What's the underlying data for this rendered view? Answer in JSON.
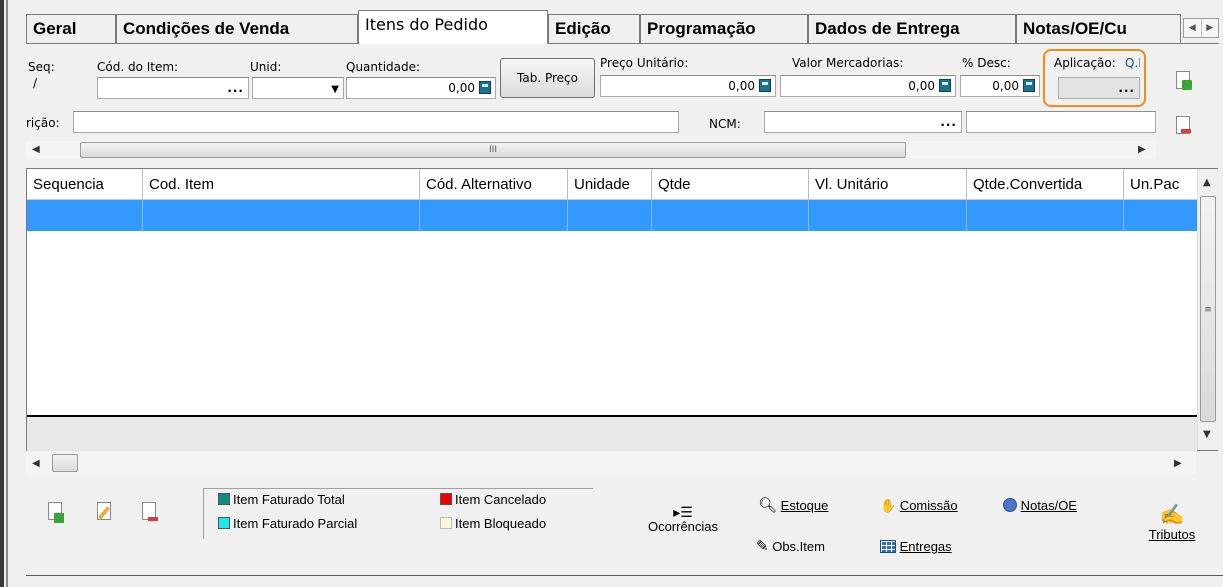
{
  "tabs": [
    {
      "label": "Geral"
    },
    {
      "label": "Condições de Venda"
    },
    {
      "label": "Itens do Pedido"
    },
    {
      "label": "Edição"
    },
    {
      "label": "Programação"
    },
    {
      "label": "Dados de Entrega"
    },
    {
      "label": "Notas/OE/Cu"
    }
  ],
  "form": {
    "seq_label": "Seq:",
    "seq_value": "/",
    "cod_item_label": "Cód. do Item:",
    "unid_label": "Unid:",
    "quantidade_label": "Quantidade:",
    "quantidade_value": "0,00",
    "tab_preco_label": "Tab. Preço",
    "preco_unitario_label": "Preço Unitário:",
    "preco_unitario_value": "0,00",
    "valor_mercadorias_label": "Valor Mercadorias:",
    "valor_mercadorias_value": "0,00",
    "desc_label": "% Desc:",
    "desc_value": "0,00",
    "aplicacao_label": "Aplicação:",
    "aplicacao_extra": "Q.I",
    "descricao_label": "rição:",
    "ncm_label": "NCM:",
    "dots": "..."
  },
  "grid": {
    "columns": [
      "Sequencia",
      "Cod. Item",
      "Cód. Alternativo",
      "Unidade",
      "Qtde",
      "Vl. Unitário",
      "Qtde.Convertida",
      "Un.Pac"
    ],
    "rows": [
      [
        "",
        "",
        "",
        "",
        "",
        "",
        "",
        ""
      ]
    ]
  },
  "legend": {
    "faturado_total": "Item Faturado Total",
    "faturado_parcial": "Item Faturado Parcial",
    "cancelado": "Item Cancelado",
    "bloqueado": "Item Bloqueado"
  },
  "colors": {
    "faturado_total": "#138a80",
    "faturado_parcial": "#19e8f0",
    "cancelado": "#ee0000",
    "bloqueado": "#fbf8d8",
    "selection": "#3399ff",
    "highlight": "#f08c1a"
  },
  "toolbar": {
    "ocorrencias": "Ocorrências",
    "estoque": "Estoque",
    "obs_item": "Obs.Item",
    "comissao": "Comissão",
    "entregas": "Entregas",
    "notas_oe": "Notas/OE",
    "tributos": "Tributos"
  },
  "scroll": {
    "grip": "III"
  }
}
